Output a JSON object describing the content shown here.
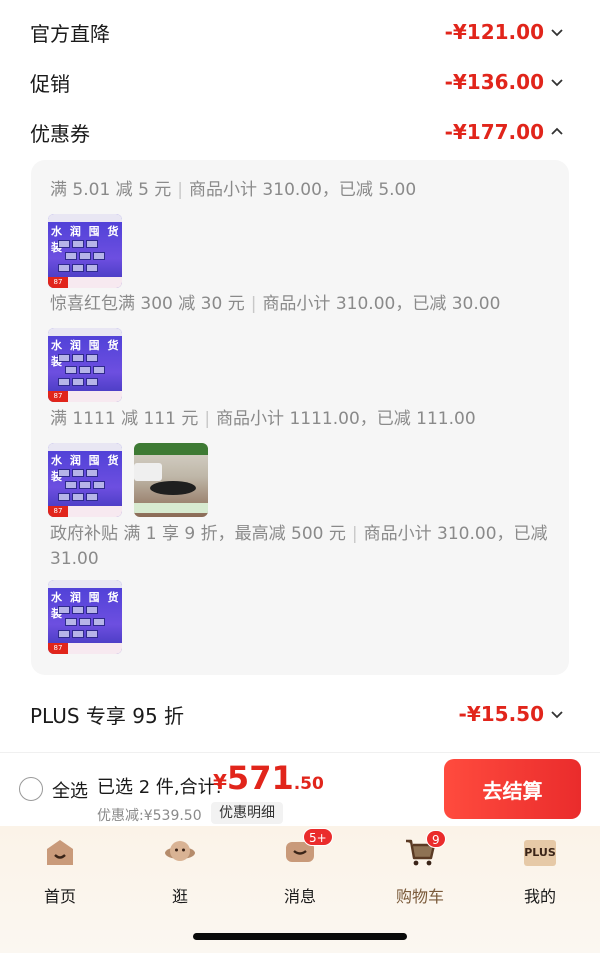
{
  "price_rows": [
    {
      "label": "官方直降",
      "amount": "-¥121.00"
    },
    {
      "label": "促销",
      "amount": "-¥136.00"
    },
    {
      "label": "优惠券",
      "amount": "-¥177.00"
    }
  ],
  "coupon_details": [
    {
      "name": "满 5.01 减 5 元",
      "note": "商品小计 310.00，已减 5.00",
      "thumbs": [
        "water-goods"
      ]
    },
    {
      "name": "惊喜红包满 300 减 30 元",
      "note": "商品小计 310.00，已减 30.00",
      "thumbs": [
        "water-goods"
      ]
    },
    {
      "name": "满 1111 减 111 元",
      "note": "商品小计 1111.00，已减 111.00",
      "thumbs": [
        "water-goods",
        "furniture"
      ]
    },
    {
      "name": "政府补贴 满 1 享 9 折，最高减 500 元",
      "note": "商品小计 310.00，已减",
      "note2": "31.00",
      "thumbs": [
        "water-goods"
      ]
    }
  ],
  "thumb_text": {
    "goods_title": "水 润 囤 货 装",
    "goods_badge": "87"
  },
  "plus_row": {
    "label": "PLUS 专享 95 折",
    "amount": "-¥15.50"
  },
  "footer": {
    "select_all": "全选",
    "summary": "已选 2 件,合计:",
    "currency": "¥",
    "total_int": "571",
    "total_dec": ".50",
    "discount": "优惠减:¥539.50",
    "detail_button": "优惠明细",
    "checkout_button": "去结算"
  },
  "tabs": [
    {
      "label": "首页",
      "icon": "home-icon"
    },
    {
      "label": "逛",
      "icon": "planet-icon"
    },
    {
      "label": "消息",
      "icon": "message-icon",
      "badge": "5+"
    },
    {
      "label": "购物车",
      "icon": "cart-icon",
      "badge": "9",
      "active": true
    },
    {
      "label": "我的",
      "icon": "plus-member-icon",
      "icon_text": "PLUS"
    }
  ],
  "colors": {
    "accent": "#e1251b",
    "checkout": "#ea2c2c",
    "muted": "#8a8a8a"
  }
}
